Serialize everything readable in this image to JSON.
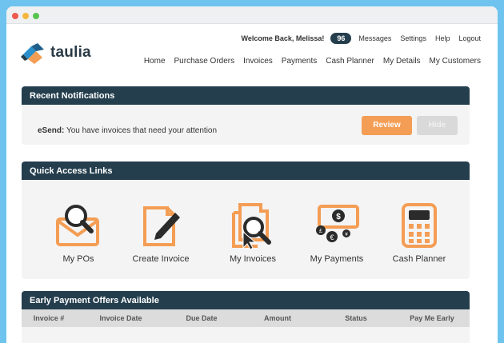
{
  "brand": {
    "name": "taulia"
  },
  "user_bar": {
    "welcome": "Welcome Back, Melissa!",
    "count": "96",
    "links": [
      "Messages",
      "Settings",
      "Help",
      "Logout"
    ]
  },
  "nav": [
    "Home",
    "Purchase Orders",
    "Invoices",
    "Payments",
    "Cash Planner",
    "My Details",
    "My Customers"
  ],
  "notifications": {
    "title": "Recent Notifications",
    "sender": "eSend:",
    "message": "You have invoices that need your attention",
    "review_label": "Review",
    "hide_label": "Hide"
  },
  "quick_links": {
    "title": "Quick Access Links",
    "items": [
      "My POs",
      "Create Invoice",
      "My Invoices",
      "My Payments",
      "Cash Planner"
    ],
    "currency_symbols": [
      "$",
      "£",
      "€",
      "¥"
    ]
  },
  "offers": {
    "title": "Early Payment Offers Available",
    "columns": [
      "Invoice #",
      "Invoice Date",
      "Due Date",
      "Amount",
      "Status",
      "Pay Me Early"
    ]
  },
  "colors": {
    "accent_orange": "#f49d54",
    "header_navy": "#243e4d",
    "background_blue": "#6ec4ee"
  }
}
